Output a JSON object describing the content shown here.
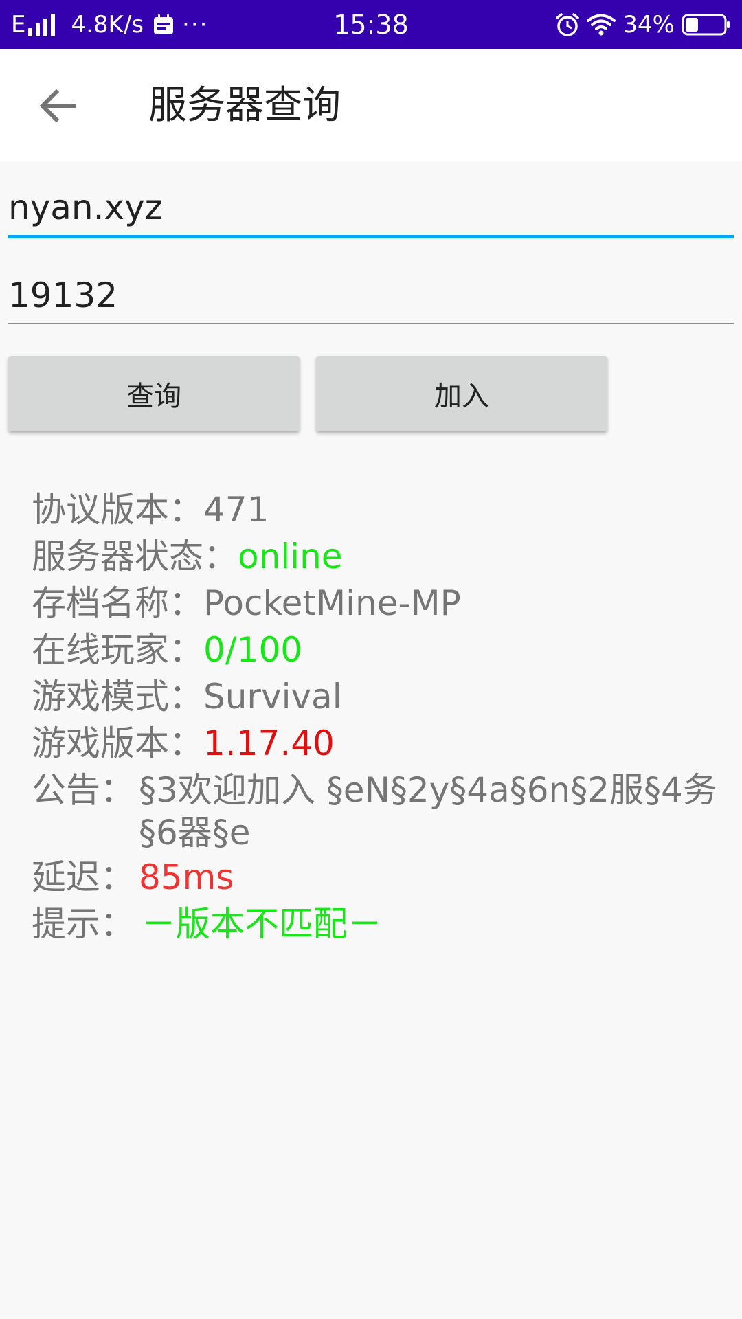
{
  "status_bar": {
    "network_type": "E",
    "net_speed": "4.8K/s",
    "more": "···",
    "time": "15:38",
    "battery_percent": "34%",
    "battery_level": 0.34,
    "background_color": "#3500ad"
  },
  "app_bar": {
    "back_icon": "arrow-left-icon",
    "title": "服务器查询"
  },
  "form": {
    "host_value": "nyan.xyz",
    "port_value": "19132",
    "active_underline_color": "#03a9f4"
  },
  "buttons": {
    "query_label": "查询",
    "join_label": "加入"
  },
  "info": {
    "protocol_label": "协议版本：",
    "protocol_value": "471",
    "status_label": "服务器状态：",
    "status_value": "online",
    "world_label": "存档名称：",
    "world_value": "PocketMine-MP",
    "players_label": "在线玩家：",
    "players_value": "0/100",
    "gamemode_label": "游戏模式：",
    "gamemode_value": "Survival",
    "version_label": "游戏版本：",
    "version_value": "1.17.40",
    "motd_label": "公告：",
    "motd_value": "§3欢迎加入 §eN§2y§4a§6n§2服§4务§6器§e",
    "latency_label": "延迟：",
    "latency_value": "85ms",
    "hint_label": "提示：",
    "hint_value": "－版本不匹配－"
  },
  "colors": {
    "online_green": "#19e619",
    "version_red": "#e01010",
    "latency_red": "#ee3333",
    "label_gray": "#757575"
  }
}
